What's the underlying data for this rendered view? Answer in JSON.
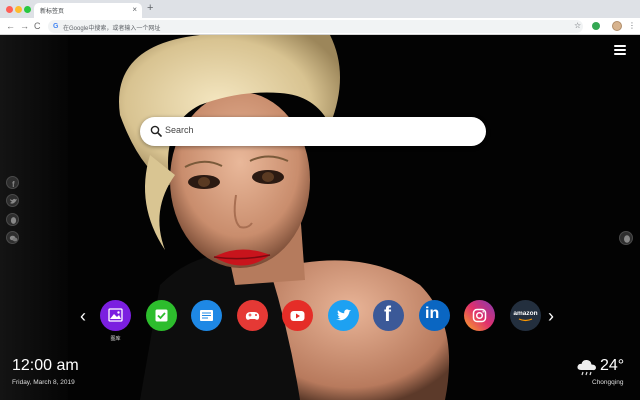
{
  "browser": {
    "tab_title": "新标签页",
    "tab_close": "×",
    "new_tab": "+",
    "omnibox_placeholder": "在Google中搜索，或者输入一个网址",
    "back": "←",
    "forward": "→",
    "reload": "C",
    "google_letter": "G",
    "star": "☆",
    "kebab": "⋮"
  },
  "search": {
    "placeholder": "Search"
  },
  "nav": {
    "prev": "‹",
    "next": "›"
  },
  "apps": [
    {
      "name": "gallery",
      "label": "图库",
      "color": "#7b1fe0"
    },
    {
      "name": "tasks",
      "label": "",
      "color": "#2dbd2d"
    },
    {
      "name": "notes",
      "label": "",
      "color": "#1e88e5"
    },
    {
      "name": "games",
      "label": "",
      "color": "#e53935"
    },
    {
      "name": "youtube",
      "label": "",
      "color": "#e52d27"
    },
    {
      "name": "twitter",
      "label": "",
      "color": "#1da1f2"
    },
    {
      "name": "facebook",
      "label": "",
      "color": "#3b5998"
    },
    {
      "name": "linkedin",
      "label": "",
      "color": "#0a66c2"
    },
    {
      "name": "instagram",
      "label": "",
      "color": "#c13584"
    },
    {
      "name": "amazon",
      "label": "",
      "color": "#232f3e"
    }
  ],
  "amazon_text": "amazon",
  "linkedin_text": "in",
  "facebook_text": "f",
  "clock": {
    "time": "12:00 am",
    "date": "Friday, March 8, 2019"
  },
  "weather": {
    "icon": "cloud-rain-icon",
    "temp": "24°",
    "city": "Chongqing"
  },
  "social_icons": [
    "facebook-icon",
    "twitter-icon",
    "qq-icon",
    "wechat-icon"
  ],
  "colors": {
    "background": "#000000",
    "search_bg": "#ffffff",
    "text_light": "#ffffff"
  }
}
